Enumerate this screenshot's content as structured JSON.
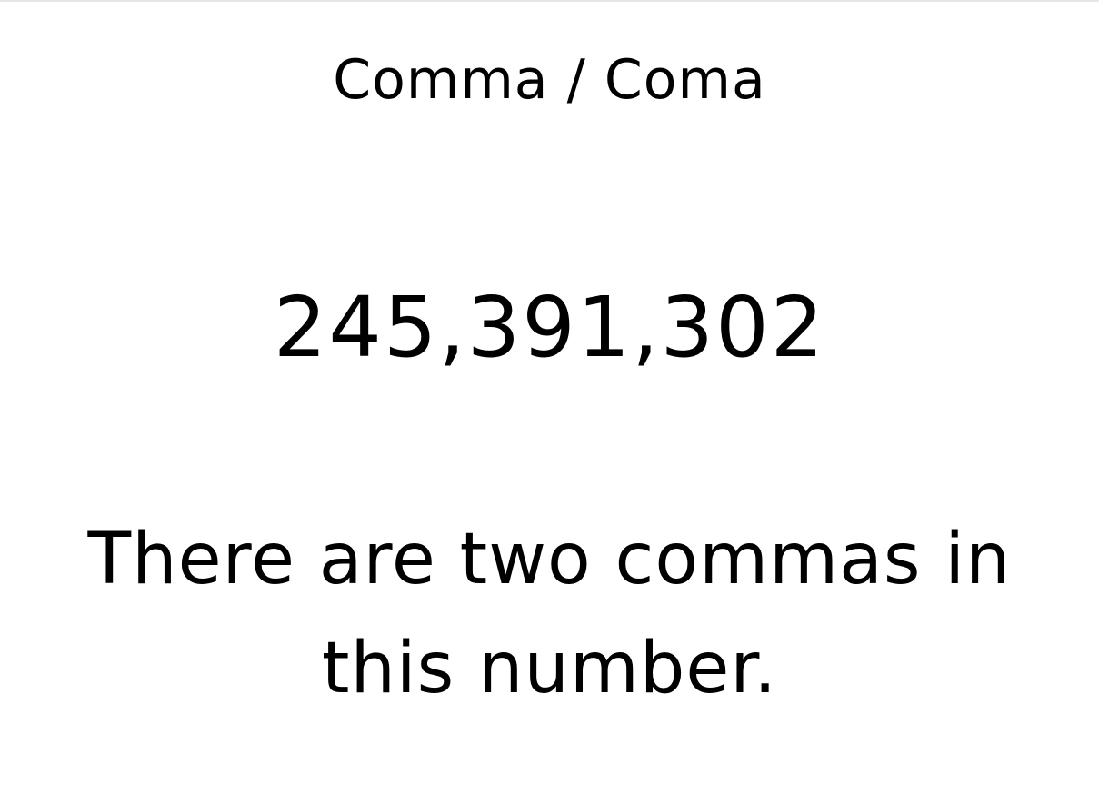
{
  "slide": {
    "title": "Comma / Coma",
    "number": "245,391,302",
    "sentence": "There are two commas in this number."
  }
}
